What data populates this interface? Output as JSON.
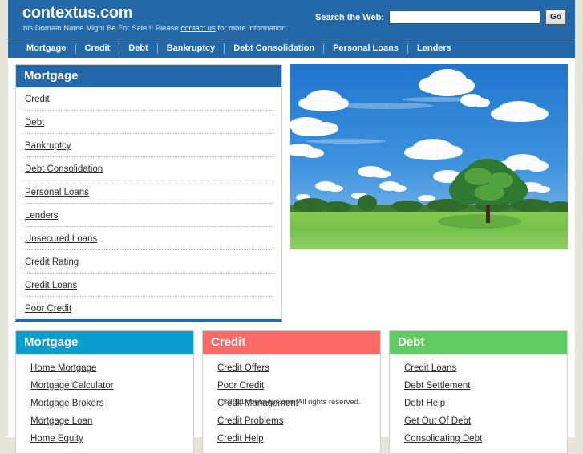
{
  "header": {
    "brand": "contextus.com",
    "tagline_before": "his Domain Name Might Be For Sale!!! Please ",
    "tagline_link": "contact us",
    "tagline_after": " for more information.",
    "search_label": "Search the Web:",
    "search_value": "",
    "search_placeholder": "",
    "go_label": "Go",
    "bg_color": "#2368a8"
  },
  "nav": {
    "items": [
      {
        "label": "Mortgage"
      },
      {
        "label": "Credit"
      },
      {
        "label": "Debt"
      },
      {
        "label": "Bankruptcy"
      },
      {
        "label": "Debt Consolidation"
      },
      {
        "label": "Personal Loans"
      },
      {
        "label": "Lenders"
      }
    ]
  },
  "sidebar": {
    "title": "Mortgage",
    "accent": "#2368a8",
    "items": [
      {
        "label": "Credit"
      },
      {
        "label": "Debt"
      },
      {
        "label": "Bankruptcy"
      },
      {
        "label": "Debt Consolidation"
      },
      {
        "label": "Personal Loans"
      },
      {
        "label": "Lenders"
      },
      {
        "label": "Unsecured Loans"
      },
      {
        "label": "Credit Rating"
      },
      {
        "label": "Credit Loans"
      },
      {
        "label": "Poor Credit"
      }
    ]
  },
  "hero": {
    "alt": "Green meadow with a lone tree under a blue sky with white clouds",
    "sky_color": "#2f86d4",
    "field_color": "#74c24a"
  },
  "boxes": [
    {
      "title": "Mortgage",
      "color": "#0b9dd0",
      "items": [
        {
          "label": "Home Mortgage"
        },
        {
          "label": "Mortgage Calculator"
        },
        {
          "label": "Mortgage Brokers"
        },
        {
          "label": "Mortgage Loan"
        },
        {
          "label": "Home Equity"
        }
      ]
    },
    {
      "title": "Credit",
      "color": "#fb6a66",
      "items": [
        {
          "label": "Credit Offers"
        },
        {
          "label": "Poor Credit"
        },
        {
          "label": "Credit Management"
        },
        {
          "label": "Credit Problems"
        },
        {
          "label": "Credit Help"
        }
      ]
    },
    {
      "title": "Debt",
      "color": "#5fcb63",
      "items": [
        {
          "label": "Credit Loans"
        },
        {
          "label": "Debt Settlement"
        },
        {
          "label": "Debt Help"
        },
        {
          "label": "Get Out Of Debt"
        },
        {
          "label": "Consolidating Debt"
        }
      ]
    }
  ],
  "footer": {
    "copyright": "©2011 contextus.com All rights reserved."
  }
}
